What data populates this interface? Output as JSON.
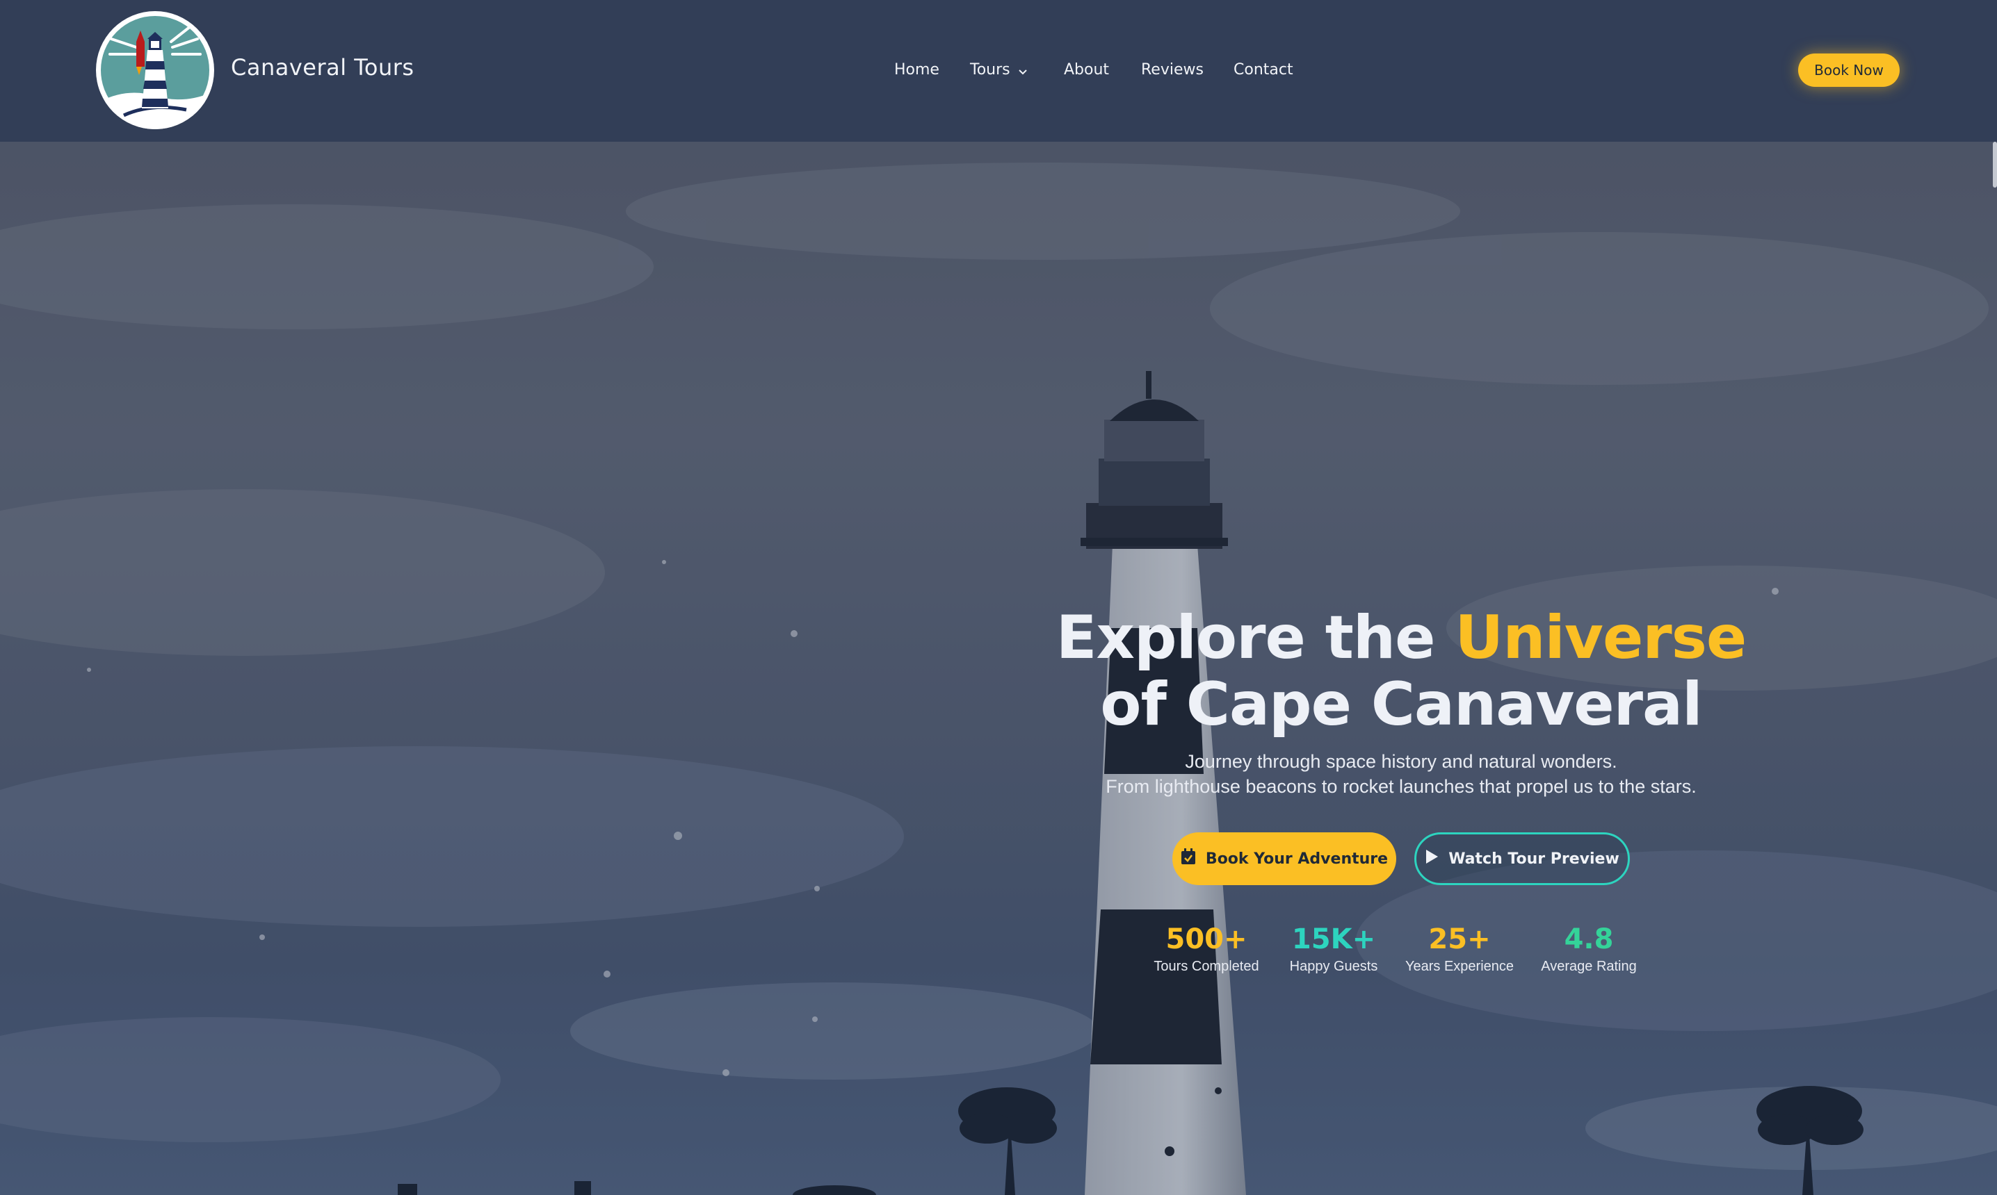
{
  "brand": {
    "name": "Canaveral Tours",
    "logo_icon": "lighthouse-rocket-logo"
  },
  "nav": {
    "items": [
      {
        "label": "Home"
      },
      {
        "label": "Tours",
        "has_dropdown": true
      },
      {
        "label": "About"
      },
      {
        "label": "Reviews"
      },
      {
        "label": "Contact"
      }
    ],
    "cta_label": "Book Now"
  },
  "hero": {
    "headline_prefix": "Explore the ",
    "headline_accent": "Universe",
    "headline_line2": "of Cape Canaveral",
    "subline_1": "Journey through space history and natural wonders.",
    "subline_2": "From lighthouse beacons to rocket launches that propel us to the stars.",
    "primary_cta": {
      "label": "Book Your Adventure",
      "icon": "calendar-icon"
    },
    "secondary_cta": {
      "label": "Watch Tour Preview",
      "icon": "play-icon"
    },
    "background": "lighthouse-under-cloudy-sky"
  },
  "stats": [
    {
      "value": "500+",
      "label": "Tours Completed",
      "color": "#fbbf24"
    },
    {
      "value": "15K+",
      "label": "Happy Guests",
      "color": "#2dd4bf"
    },
    {
      "value": "25+",
      "label": "Years Experience",
      "color": "#fbbf24"
    },
    {
      "value": "4.8",
      "label": "Average Rating",
      "color": "#34d399"
    }
  ],
  "colors": {
    "header_bg": "#323e57",
    "accent_yellow": "#fbbf24",
    "accent_teal": "#2dd4bf",
    "accent_green": "#34d399"
  }
}
